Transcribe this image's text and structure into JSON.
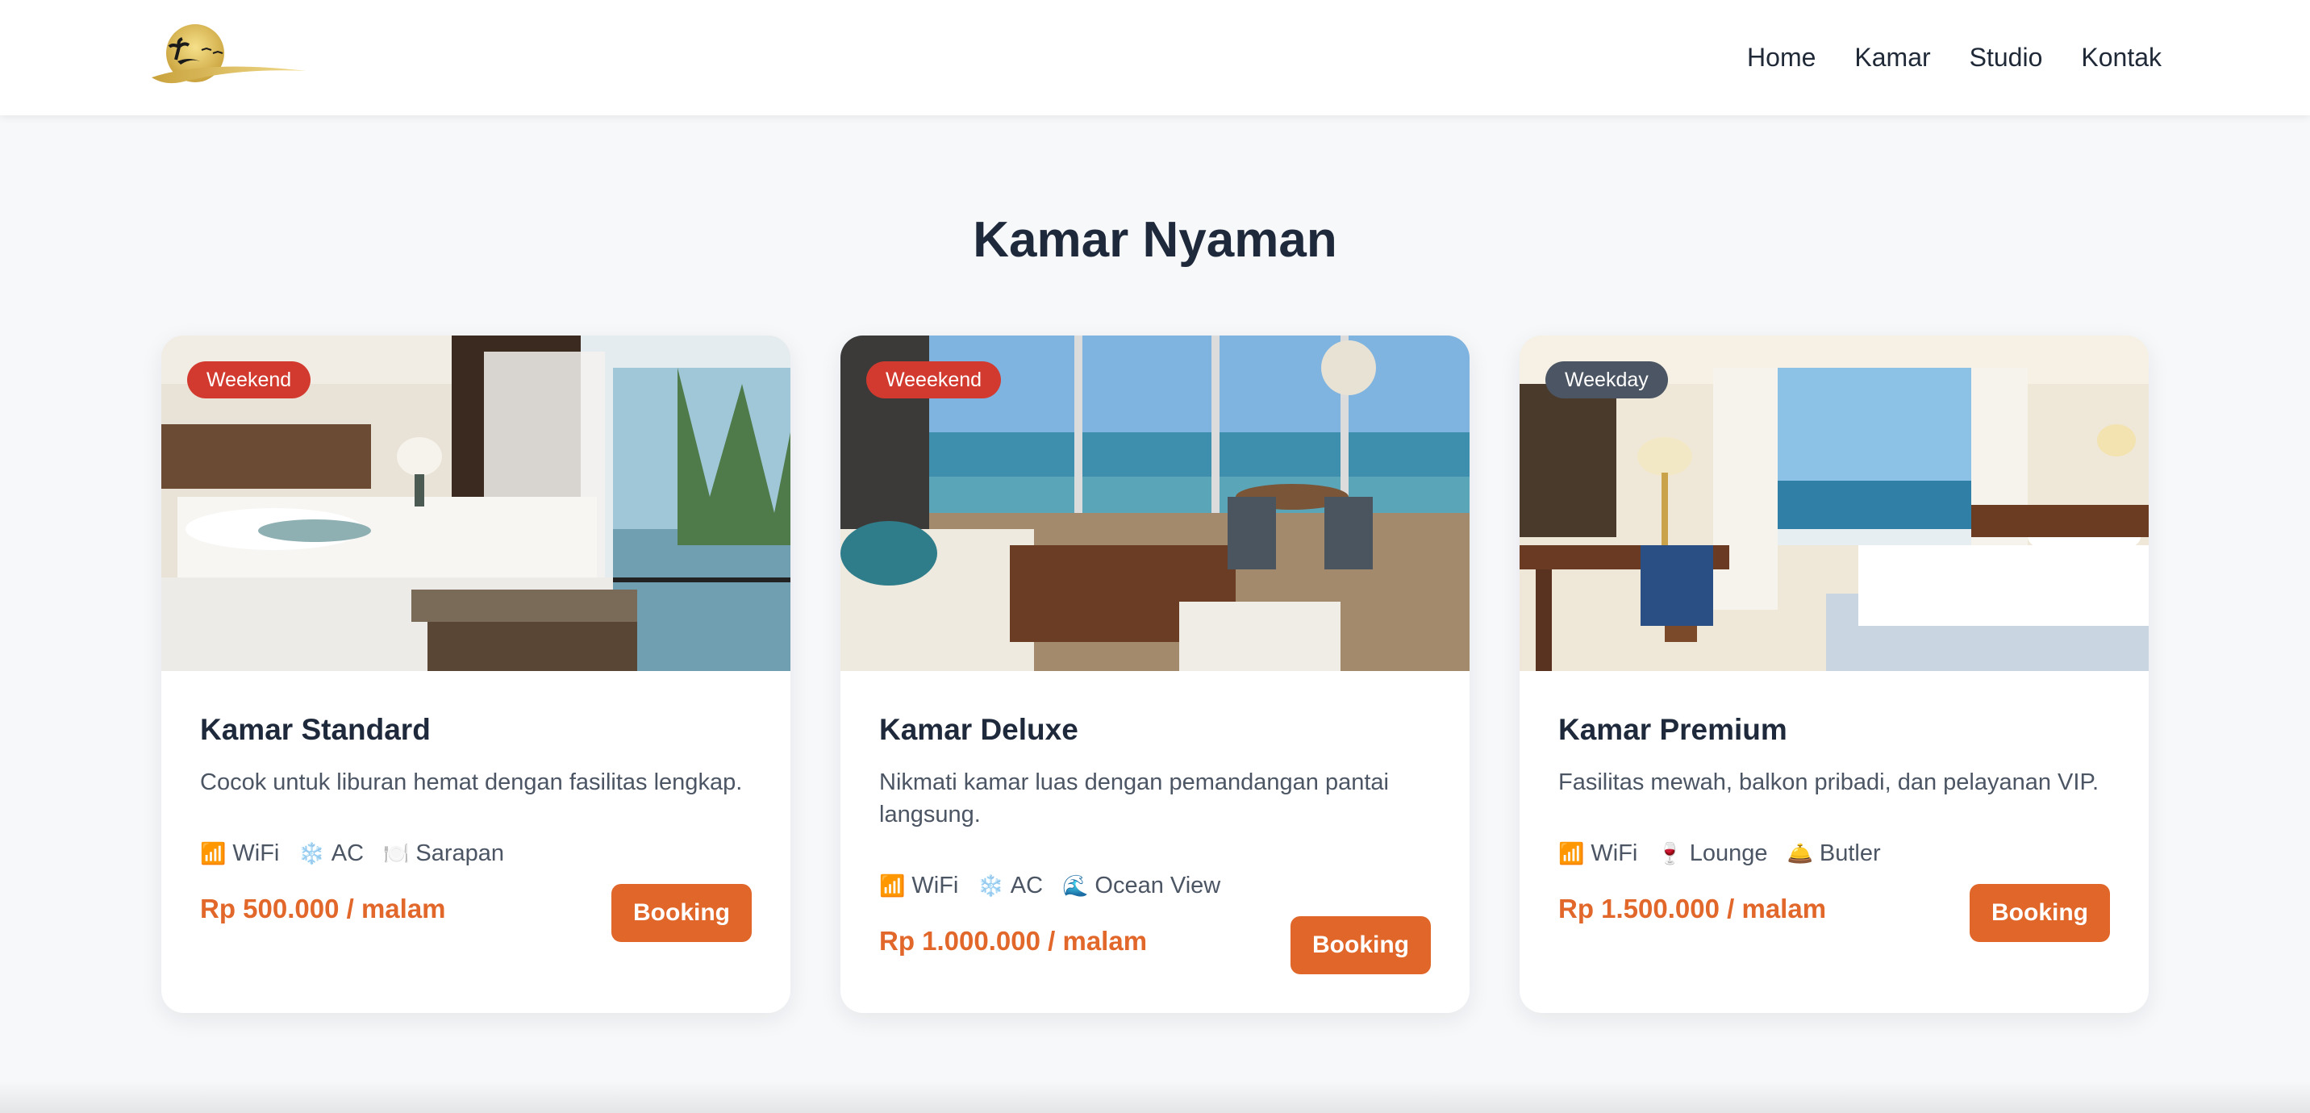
{
  "nav": {
    "logo_icon": "palm-sunset-logo",
    "links": [
      "Home",
      "Kamar",
      "Studio",
      "Kontak"
    ]
  },
  "section": {
    "title": "Kamar Nyaman"
  },
  "colors": {
    "accent": "#e0662a",
    "badge_red": "#d23a2f",
    "badge_gray": "#4b5563"
  },
  "cards": [
    {
      "badge": "Weekend",
      "badge_color": "red",
      "title": "Kamar Standard",
      "description": "Cocok untuk liburan hemat dengan fasilitas lengkap.",
      "features": [
        {
          "icon": "📶",
          "label": "WiFi"
        },
        {
          "icon": "❄️",
          "label": "AC"
        },
        {
          "icon": "🍽️",
          "label": "Sarapan"
        }
      ],
      "price": "Rp 500.000 / malam",
      "button": "Booking"
    },
    {
      "badge": "Weeekend",
      "badge_color": "red",
      "title": "Kamar Deluxe",
      "description": "Nikmati kamar luas dengan pemandangan pantai langsung.",
      "features": [
        {
          "icon": "📶",
          "label": "WiFi"
        },
        {
          "icon": "❄️",
          "label": "AC"
        },
        {
          "icon": "🌊",
          "label": "Ocean View"
        }
      ],
      "price": "Rp 1.000.000 / malam",
      "button": "Booking"
    },
    {
      "badge": "Weekday",
      "badge_color": "gray",
      "title": "Kamar Premium",
      "description": "Fasilitas mewah, balkon pribadi, dan pelayanan VIP.",
      "features": [
        {
          "icon": "📶",
          "label": "WiFi"
        },
        {
          "icon": "🍷",
          "label": "Lounge"
        },
        {
          "icon": "🛎️",
          "label": "Butler"
        }
      ],
      "price": "Rp 1.500.000 / malam",
      "button": "Booking"
    }
  ]
}
